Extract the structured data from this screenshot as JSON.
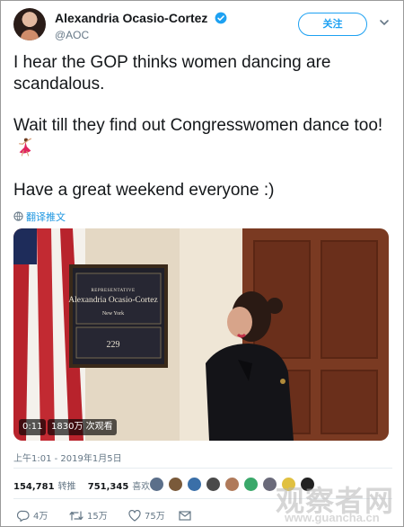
{
  "author": {
    "display_name": "Alexandria Ocasio-Cortez",
    "handle": "@AOC",
    "verified_icon": "verified-badge-icon",
    "avatar": "avatar"
  },
  "follow_button": {
    "label": "关注"
  },
  "more_icon": "chevron-down-icon",
  "tweet": {
    "line1": "I hear the GOP thinks women dancing are scandalous.",
    "line2": "Wait till they find out Congresswomen dance too!",
    "line2_emoji": "dancer-emoji-icon",
    "line3": "Have a great weekend everyone :)"
  },
  "translate": {
    "label": "翻译推文",
    "icon": "globe-icon"
  },
  "media": {
    "plaque_title": "REPRESENTATIVE",
    "plaque_name": "Alexandria Ocasio-Cortez",
    "plaque_state": "New York",
    "plaque_room": "229",
    "duration": "0:11",
    "views": "1830万 次观看"
  },
  "timestamp": "上午1:01 - 2019年1月5日",
  "stats": {
    "retweets_count": "154,781",
    "retweets_label": "转推",
    "likes_count": "751,345",
    "likes_label": "喜欢"
  },
  "actions": {
    "reply": "4万",
    "retweet": "15万",
    "like": "75万"
  },
  "watermark": {
    "cn": "观察者网",
    "url": "www.guancha.cn"
  },
  "colors": {
    "accent": "#1da1f2",
    "muted": "#657786",
    "text": "#14171a"
  }
}
